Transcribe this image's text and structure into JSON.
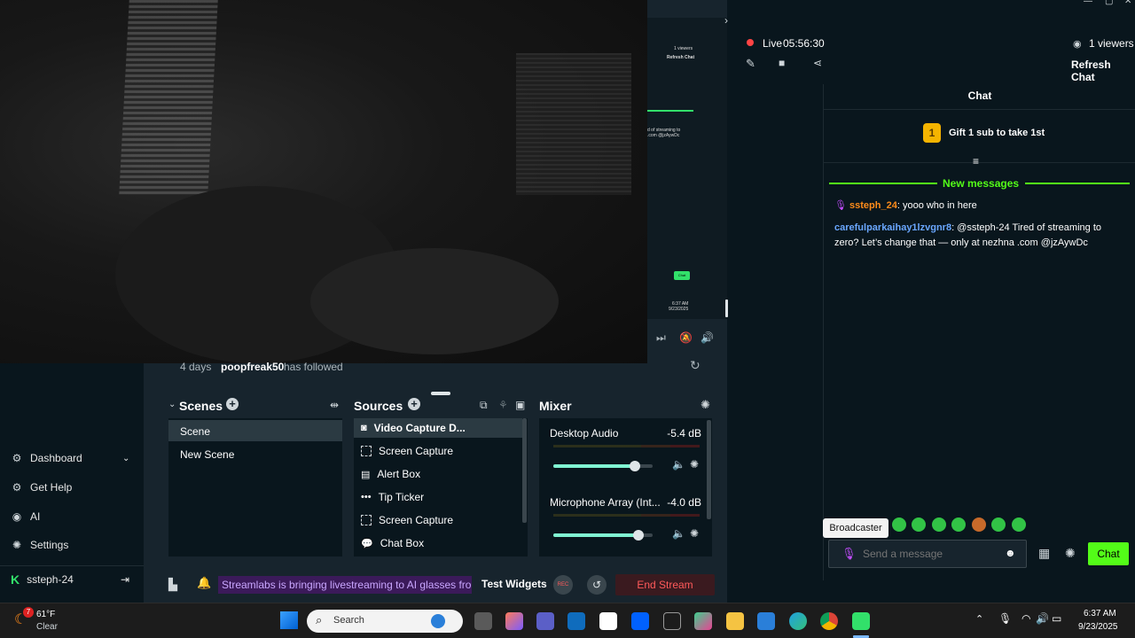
{
  "webcam": {
    "preview_viewers": "1 viewers",
    "preview_refresh": "Refresh Chat",
    "preview_chat": "Chat",
    "preview_time": "6:37 AM",
    "preview_date": "9/23/2025",
    "preview_msg": "d of streaming to\n.com @jzAywDc"
  },
  "recent_event": {
    "age": "4 days",
    "user": "poopfreak50",
    "action": "has followed"
  },
  "scenes": {
    "title": "Scenes",
    "items": [
      "Scene",
      "New Scene"
    ]
  },
  "sources": {
    "title": "Sources",
    "items": [
      "Video Capture D...",
      "Screen Capture",
      "Alert Box",
      "Tip Ticker",
      "Screen Capture",
      "Chat Box"
    ]
  },
  "mixer": {
    "title": "Mixer",
    "channels": [
      {
        "name": "Desktop Audio",
        "level": "-5.4 dB",
        "volume": 0.82
      },
      {
        "name": "Microphone Array (Int...",
        "level": "-4.0 dB",
        "volume": 0.86
      }
    ]
  },
  "sidebar": {
    "items": [
      "Dashboard",
      "Get Help",
      "AI",
      "Settings"
    ],
    "user": "ssteph-24"
  },
  "footer": {
    "ticker": "Streamlabs is bringing livestreaming to AI glasses from",
    "test_widgets": "Test Widgets",
    "rec": "REC",
    "end_stream": "End Stream"
  },
  "stream": {
    "status": "Live",
    "uptime": "05:56:30",
    "viewers": "1 viewers",
    "refresh_chat": "Refresh Chat"
  },
  "chat": {
    "title": "Chat",
    "gift_rank": "1",
    "gift_text": "Gift 1 sub to take 1st",
    "new_messages": "New messages",
    "messages": [
      {
        "user": "ssteph_24",
        "text": ": yooo who in here",
        "color": "#ff8c1a"
      },
      {
        "user": "carefulparkaihay1lzvgnr8",
        "text": ": @ssteph-24 Tired of streaming to zero? Let’s change that — only at nezhna .com @jzAywDc",
        "color": "#6aa7ff"
      }
    ],
    "tooltip": "Broadcaster",
    "placeholder": "Send a message",
    "send_label": "Chat"
  },
  "taskbar": {
    "weather_temp": "61°F",
    "weather_desc": "Clear",
    "weather_badge": "7",
    "search": "Search",
    "time": "6:37 AM",
    "date": "9/23/2025"
  },
  "colors": {
    "accent": "#80f5d2",
    "live": "#ff4444",
    "chat_green": "#53fc18",
    "end_stream": "#ff5a5a"
  }
}
